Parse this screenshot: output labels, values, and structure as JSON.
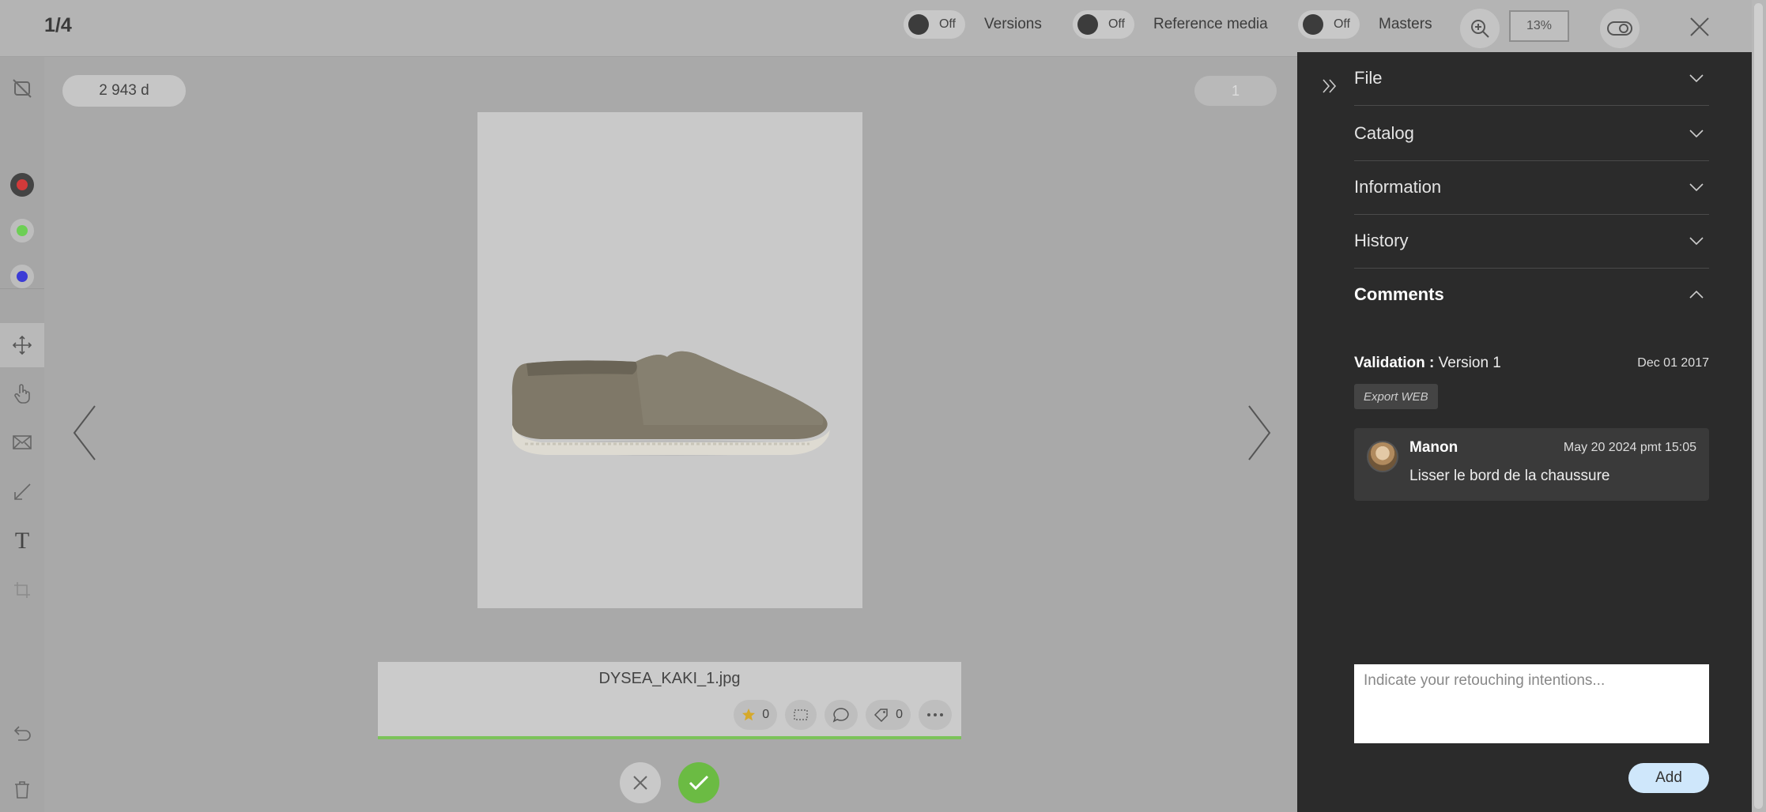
{
  "header": {
    "counter": "1/4",
    "toggles": [
      {
        "state": "Off",
        "label": "Versions"
      },
      {
        "state": "Off",
        "label": "Reference media"
      },
      {
        "state": "Off",
        "label": "Masters"
      }
    ],
    "zoom": "13%"
  },
  "toolbar": {
    "colors": [
      "#d23a3a",
      "#6dcf55",
      "#3b3bd6"
    ],
    "tools": [
      "hide-annotations-icon",
      "move-icon",
      "hand-pointer-icon",
      "envelope-icon",
      "arrow-icon",
      "text-tool-icon",
      "crop-icon",
      "undo-icon",
      "trash-icon"
    ],
    "text_tool": "T"
  },
  "canvas": {
    "age_badge": "2 943 d",
    "page_badge": "1",
    "file_name": "DYSEA_KAKI_1.jpg",
    "rating_count": "0",
    "tag_count": "0"
  },
  "panel": {
    "sections": [
      {
        "title": "File",
        "expanded": false
      },
      {
        "title": "Catalog",
        "expanded": false
      },
      {
        "title": "Information",
        "expanded": false
      },
      {
        "title": "History",
        "expanded": false
      },
      {
        "title": "Comments",
        "expanded": true
      }
    ],
    "validation": {
      "label": "Validation :",
      "value": "Version 1",
      "date": "Dec 01 2017"
    },
    "tag": "Export WEB",
    "comment": {
      "author": "Manon",
      "date": "May 20 2024 pmt 15:05",
      "text": "Lisser le bord de la chaussure"
    },
    "input_placeholder": "Indicate your retouching intentions...",
    "add_label": "Add"
  }
}
